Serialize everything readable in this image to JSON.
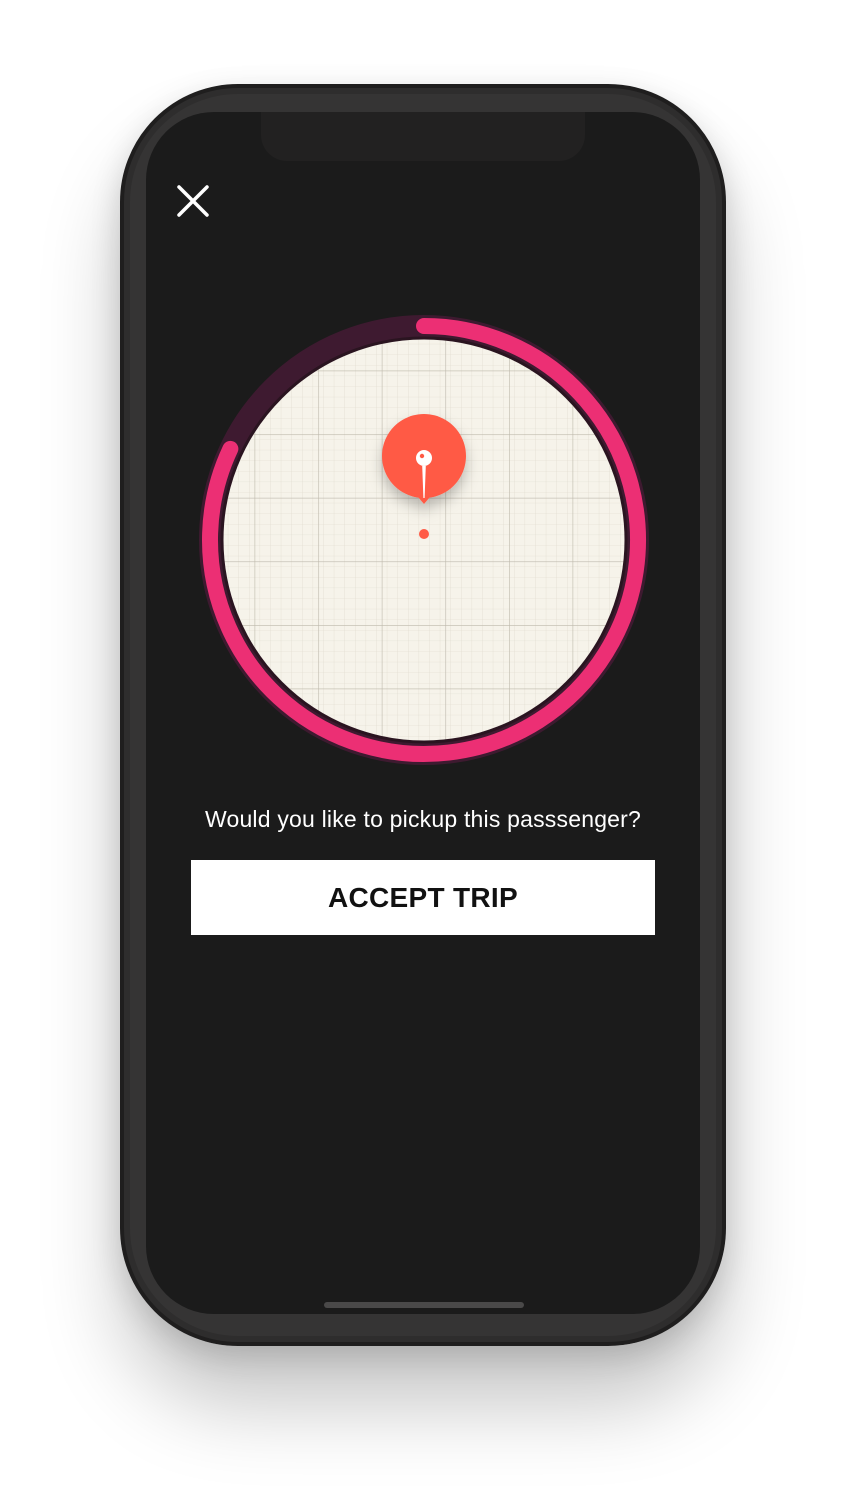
{
  "icons": {
    "close": "close-icon",
    "pin": "map-pin-icon"
  },
  "pickup": {
    "prompt": "Would you like to pickup this passsenger?",
    "accept_label": "ACCEPT TRIP",
    "countdown_progress": 0.82
  },
  "colors": {
    "accent": "#ec2f74",
    "ring_track": "#3e1a30",
    "pin": "#ff5a45",
    "map_bg": "#f6f3ea",
    "screen_bg": "#1b1b1b",
    "button_bg": "#ffffff"
  }
}
